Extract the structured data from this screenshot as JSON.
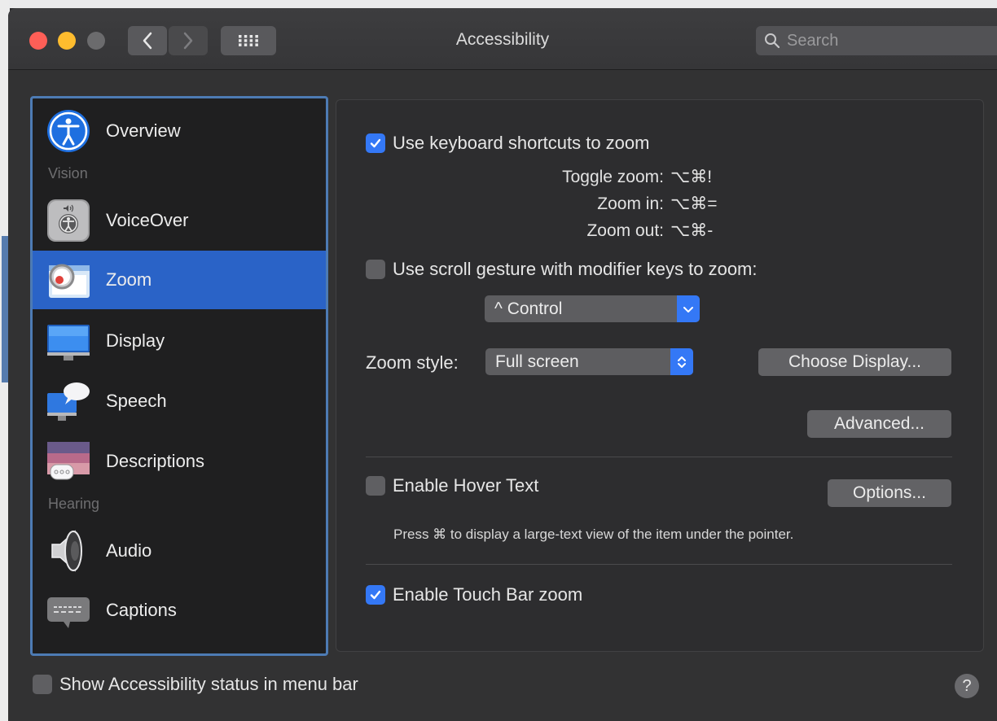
{
  "window": {
    "title": "Accessibility"
  },
  "toolbar": {
    "back_icon": "chevron-left-icon",
    "forward_icon": "chevron-right-icon",
    "grid_icon": "show-all-grid-icon"
  },
  "search": {
    "placeholder": "Search",
    "icon": "search-icon"
  },
  "sidebar": {
    "headings": {
      "vision": "Vision",
      "hearing": "Hearing"
    },
    "items": [
      {
        "label": "Overview",
        "icon": "accessibility-icon"
      },
      {
        "label": "VoiceOver",
        "icon": "voiceover-icon"
      },
      {
        "label": "Zoom",
        "icon": "zoom-icon",
        "selected": true
      },
      {
        "label": "Display",
        "icon": "display-icon"
      },
      {
        "label": "Speech",
        "icon": "speech-icon"
      },
      {
        "label": "Descriptions",
        "icon": "descriptions-icon"
      },
      {
        "label": "Audio",
        "icon": "speaker-icon"
      },
      {
        "label": "Captions",
        "icon": "captions-icon"
      }
    ],
    "accent_color": "#2a63c7"
  },
  "zoom": {
    "keyboard_shortcuts": {
      "label": "Use keyboard shortcuts to zoom",
      "checked": true
    },
    "shortcuts": [
      {
        "label": "Toggle zoom:",
        "keys": "⌥⌘!"
      },
      {
        "label": "Zoom in:",
        "keys": "⌥⌘="
      },
      {
        "label": "Zoom out:",
        "keys": "⌥⌘-"
      }
    ],
    "scroll_gesture": {
      "label": "Use scroll gesture with modifier keys to zoom:",
      "checked": false
    },
    "modifier_select": {
      "value": "^ Control"
    },
    "zoom_style": {
      "label": "Zoom style:",
      "value": "Full screen"
    },
    "choose_display_button": "Choose Display...",
    "advanced_button": "Advanced...",
    "hover_text": {
      "label": "Enable Hover Text",
      "checked": false,
      "options_button": "Options...",
      "hint": "Press ⌘ to display a large-text view of the item under the pointer."
    },
    "touch_bar_zoom": {
      "label": "Enable Touch Bar zoom",
      "checked": true
    }
  },
  "footer": {
    "status_menu_label": "Show Accessibility status in menu bar",
    "status_menu_checked": false,
    "help_label": "?"
  },
  "colors": {
    "checkbox_checked": "#3478f6",
    "close": "#fe5f57",
    "minimize": "#febc2e"
  }
}
